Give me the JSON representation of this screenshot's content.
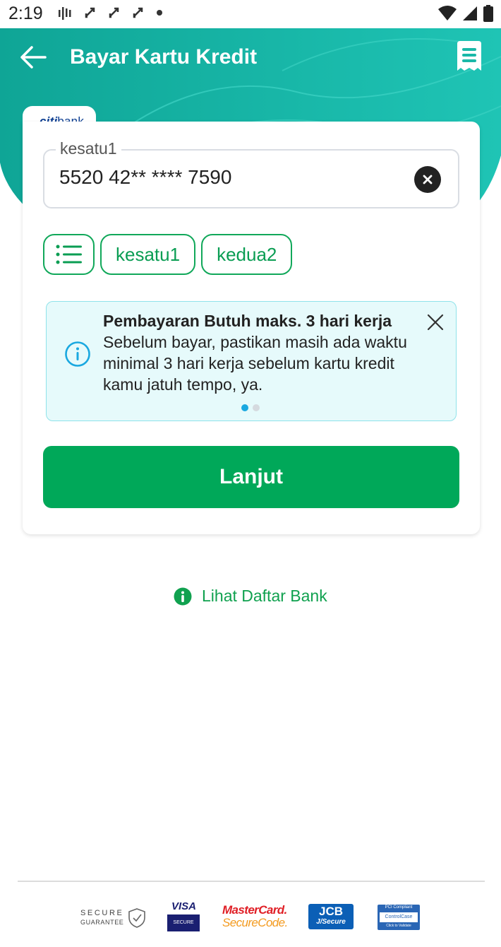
{
  "status_bar": {
    "time": "2:19"
  },
  "header": {
    "title": "Bayar Kartu Kredit",
    "back_icon": "arrow-left-icon",
    "receipt_icon": "receipt-icon",
    "accent": "#1fbfa8"
  },
  "bank": {
    "logo_text_citi": "citi",
    "logo_text_bank": "bank"
  },
  "card_field": {
    "label": "kesatu1",
    "value": "5520 42** **** 7590"
  },
  "chips": {
    "items": [
      "kesatu1",
      "kedua2"
    ]
  },
  "info_banner": {
    "title": "Pembayaran Butuh maks. 3 hari kerja",
    "text": "Sebelum bayar, pastikan masih ada waktu minimal 3 hari kerja sebelum kartu kredit kamu jatuh tempo, ya.",
    "page_count": 2,
    "active_page": 1
  },
  "submit": {
    "label": "Lanjut",
    "color": "#00a859"
  },
  "bank_list_link": {
    "label": "Lihat Daftar Bank"
  },
  "footer": {
    "secure_top": "SECURE",
    "secure_bottom": "GUARANTEE",
    "visa_top": "VISA",
    "visa_bottom": "SECURE",
    "mastercard_top": "MasterCard.",
    "mastercard_bottom": "SecureCode.",
    "jcb_top": "JCB",
    "jcb_bottom": "J/Secure",
    "pci_top": "PCI Compliant",
    "pci_middle": "ControlCase",
    "pci_bottom": "Click to Validate"
  }
}
